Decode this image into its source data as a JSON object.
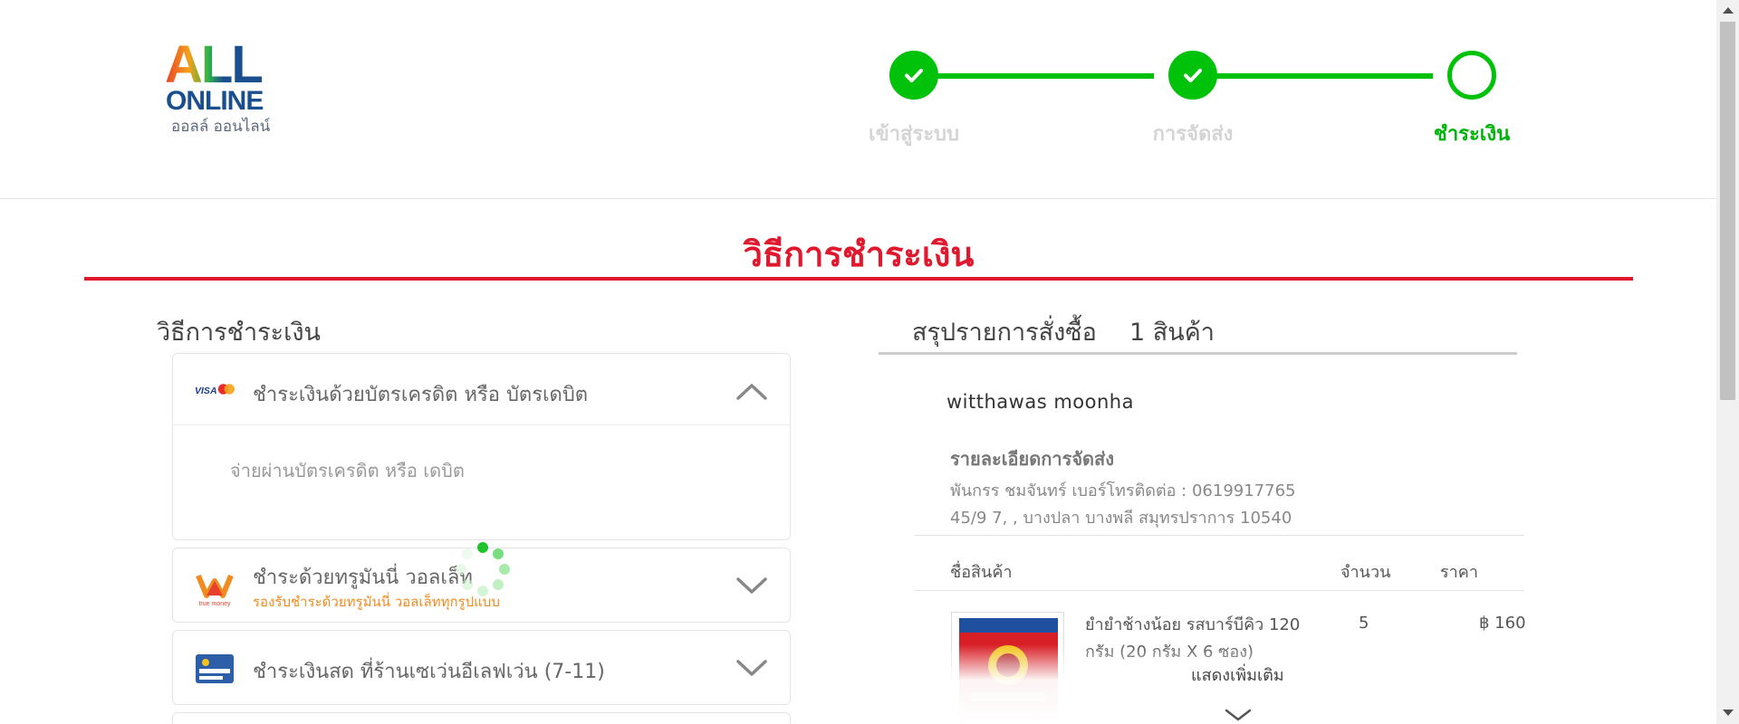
{
  "logo": {
    "word_all": "ALL",
    "word_online": "ONLINE",
    "thai_name": "ออลล์ ออนไลน์"
  },
  "stepper": {
    "steps": [
      {
        "label": "เข้าสู่ระบบ",
        "status": "done"
      },
      {
        "label": "การจัดส่ง",
        "status": "done"
      },
      {
        "label": "ชำระเงิน",
        "status": "current"
      }
    ],
    "active_color": "#00c20a"
  },
  "page_title": "วิธีการชำระเงิน",
  "payment": {
    "heading": "วิธีการชำระเงิน",
    "methods": [
      {
        "icon": "visa-mastercard-icon",
        "title": "ชำระเงินด้วยบัตรเครดิต หรือ บัตรเดบิต",
        "expanded": true,
        "body": "จ่ายผ่านบัตรเครดิต หรือ เดบิต"
      },
      {
        "icon": "truemoney-wallet-icon",
        "title": "ชำระด้วยทรูมันนี่ วอลเล็ท",
        "subtitle": "รองรับชำระด้วยทรูมันนี่ วอลเล็ททุกรูปแบบ",
        "expanded": false
      },
      {
        "icon": "counter-service-icon",
        "title": "ชำระเงินสด ที่ร้านเซเว่นอีเลฟเว่น (7-11)",
        "expanded": false
      }
    ]
  },
  "summary": {
    "heading": "สรุปรายการสั่งซื้อ",
    "item_count": "1 สินค้า",
    "customer_name": "witthawas moonha",
    "shipping": {
      "title": "รายละเอียดการจัดส่ง",
      "line1": "พันกรร ชมจันทร์ เบอร์โทรติดต่อ : 0619917765",
      "line2": "45/9 7, , บางปลา บางพลี สมุทรปราการ 10540"
    },
    "columns": {
      "name": "ชื่อสินค้า",
      "qty": "จำนวน",
      "price": "ราคา"
    },
    "items": [
      {
        "name": "ยำยำช้างน้อย รสบาร์บีคิว 120 กรัม (20 กรัม X 6 ซอง)",
        "qty": "5",
        "price": "฿ 160"
      }
    ],
    "show_more": "แสดงเพิ่มเติม"
  },
  "colors": {
    "brand_red": "#e0182d",
    "success_green": "#00c20a",
    "truemoney_orange": "#f28b1f"
  }
}
